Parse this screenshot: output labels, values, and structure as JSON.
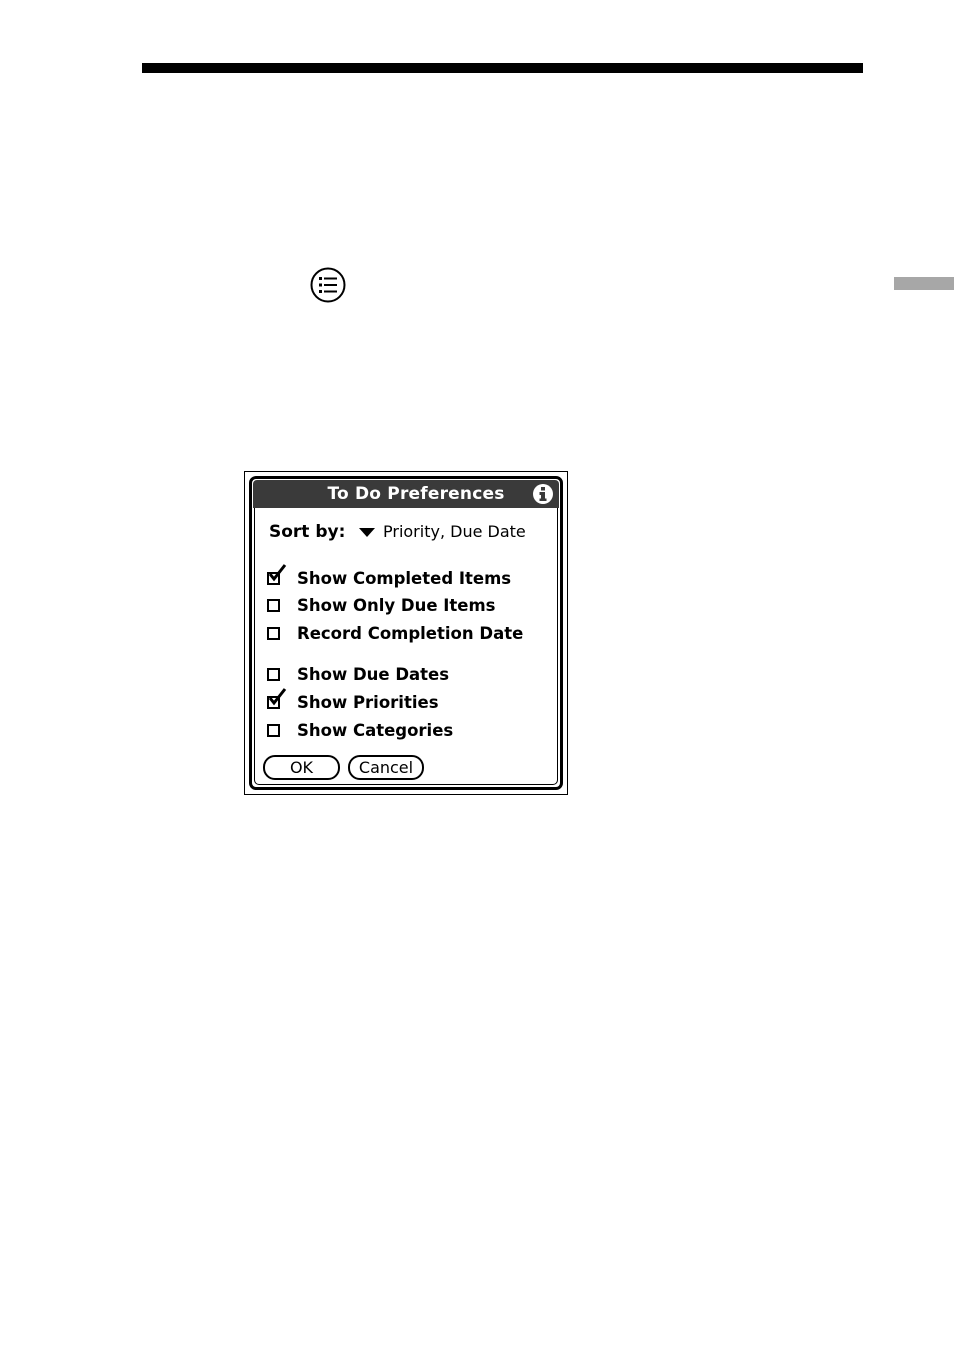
{
  "dialog": {
    "title": "To Do Preferences",
    "sort_by_label": "Sort by:",
    "sort_by_value": "Priority, Due Date",
    "options": [
      {
        "label": "Show Completed Items",
        "checked": true
      },
      {
        "label": "Show Only Due Items",
        "checked": false
      },
      {
        "label": "Record Completion Date",
        "checked": false
      },
      {
        "label": "Show Due Dates",
        "checked": false
      },
      {
        "label": "Show Priorities",
        "checked": true
      },
      {
        "label": "Show Categories",
        "checked": false
      }
    ],
    "ok_label": "OK",
    "cancel_label": "Cancel"
  },
  "icons": {
    "menu": "menu-list-icon",
    "info": "info-icon",
    "dropdown": "dropdown-arrow-icon",
    "check": "checkmark-icon"
  },
  "colors": {
    "titlebar": "#3a3a3a",
    "side_tab": "#a7a7a7"
  }
}
